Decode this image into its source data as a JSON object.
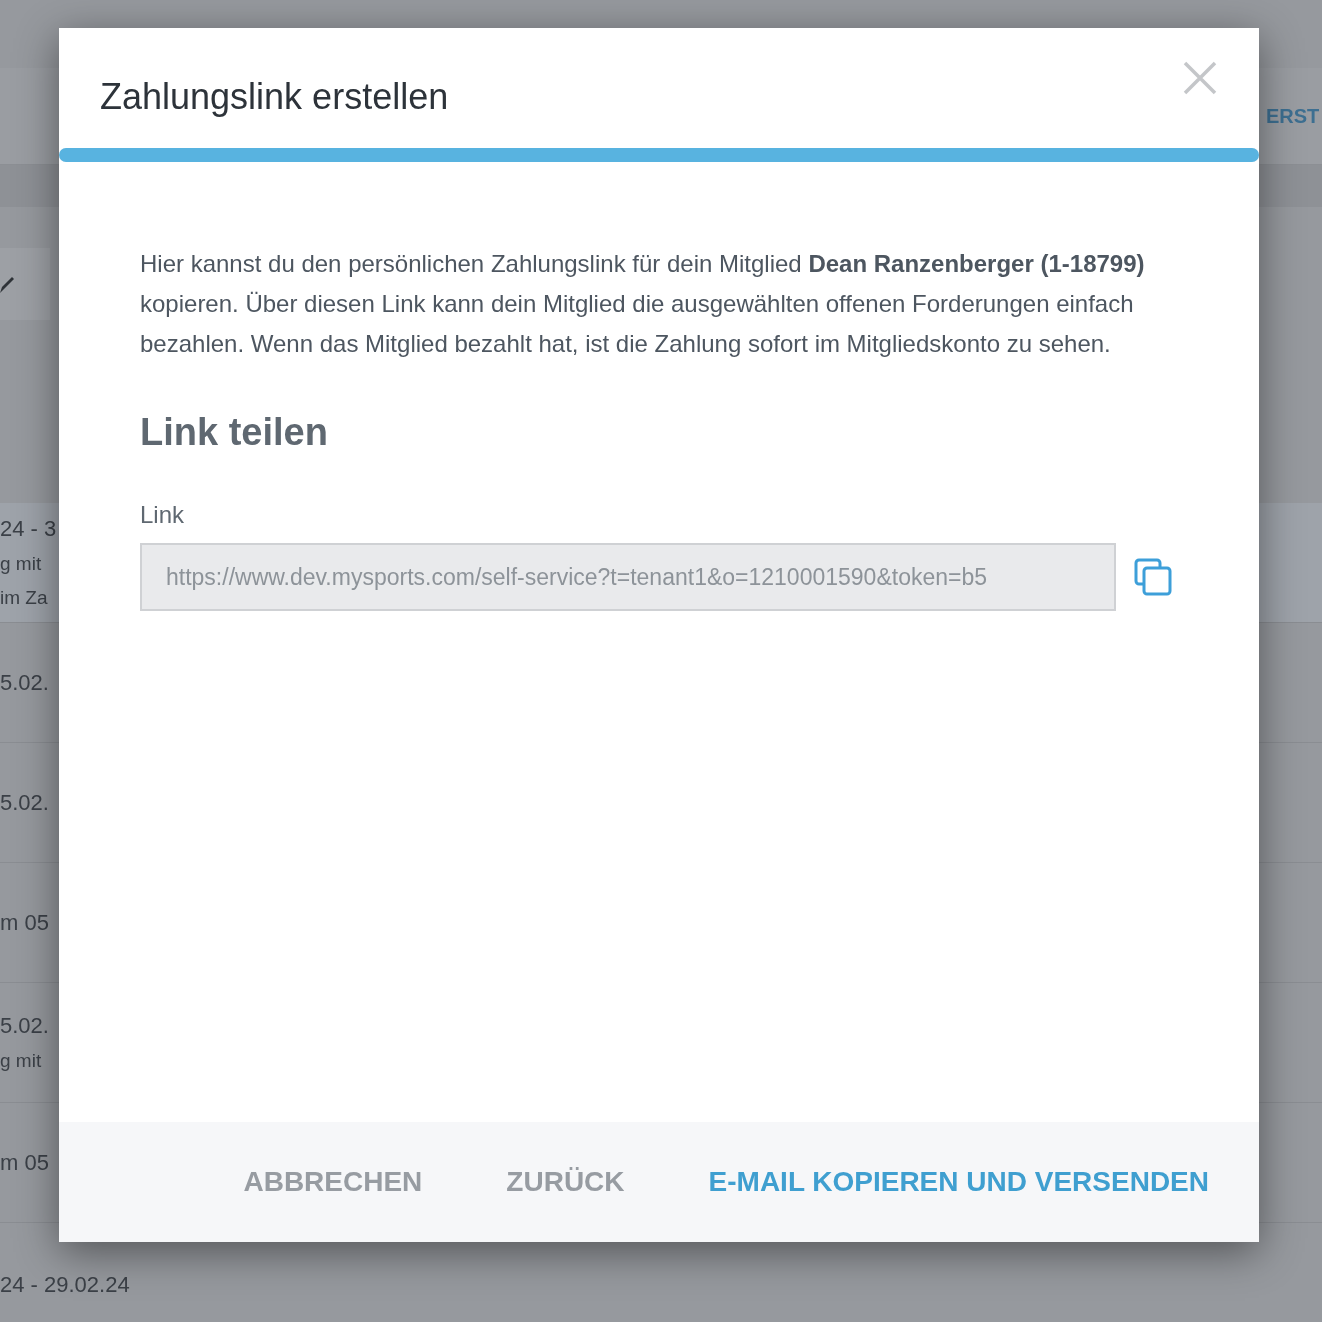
{
  "background": {
    "header_action": "ERST",
    "rows": [
      {
        "lines": [
          "24 - 3",
          "g mit",
          "im Za"
        ],
        "selected": true
      },
      {
        "lines": [
          "5.02."
        ],
        "selected": false
      },
      {
        "lines": [
          "5.02."
        ],
        "selected": false
      },
      {
        "lines": [
          "m 05"
        ],
        "selected": false
      },
      {
        "lines": [
          "5.02.",
          "g mit"
        ],
        "selected": false
      },
      {
        "lines": [
          "m 05"
        ],
        "selected": false
      },
      {
        "lines": [
          "24 - 29.02.24"
        ],
        "selected": false
      }
    ]
  },
  "dialog": {
    "title": "Zahlungslink erstellen",
    "text": "Hier kannst du den persönlichen Zahlungslink für dein Mitglied **Dean Ranzenberger (1-18799)** kopieren. Über diesen Link kann dein Mitglied die ausgewählten offenen Forderungen einfach bezahlen. Wenn das Mitglied bezahlt hat, ist die Zahlung sofort im Mitgliedskonto zu sehen.",
    "progress": {
      "level": 1
    },
    "section_title": "Link teilen",
    "field": {
      "label": "Link",
      "value": "https://www.dev.mysports.com/self-service?t=tenant1&o=1210001590&token=b5",
      "disabled": true
    },
    "buttons": [
      {
        "label": "ABBRECHEN",
        "kind": "secondary"
      },
      {
        "label": "ZURÜCK",
        "kind": "secondary"
      },
      {
        "label": "E-MAIL KOPIEREN UND VERSENDEN",
        "kind": "primary"
      }
    ]
  }
}
